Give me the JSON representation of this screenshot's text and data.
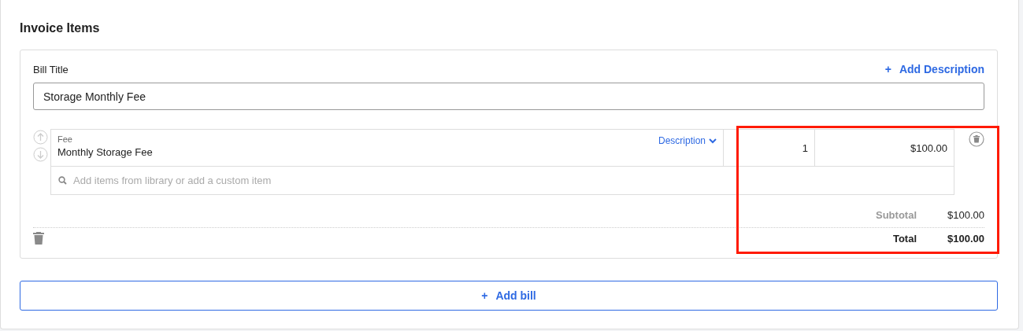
{
  "section": {
    "title": "Invoice Items"
  },
  "bill": {
    "title_label": "Bill Title",
    "add_description": {
      "icon": "+",
      "label": "Add Description"
    },
    "title_value": "Storage Monthly Fee",
    "items": [
      {
        "type_label": "Fee",
        "name": "Monthly Storage Fee",
        "description_toggle": "Description",
        "quantity": "1",
        "price": "$100.00"
      }
    ],
    "search": {
      "placeholder": "Add items from library or add a custom item"
    },
    "subtotal": {
      "label": "Subtotal",
      "value": "$100.00"
    },
    "total": {
      "label": "Total",
      "value": "$100.00"
    }
  },
  "add_bill": {
    "icon": "+",
    "label": "Add bill"
  },
  "annotation": {
    "kind": "highlight-frame"
  }
}
